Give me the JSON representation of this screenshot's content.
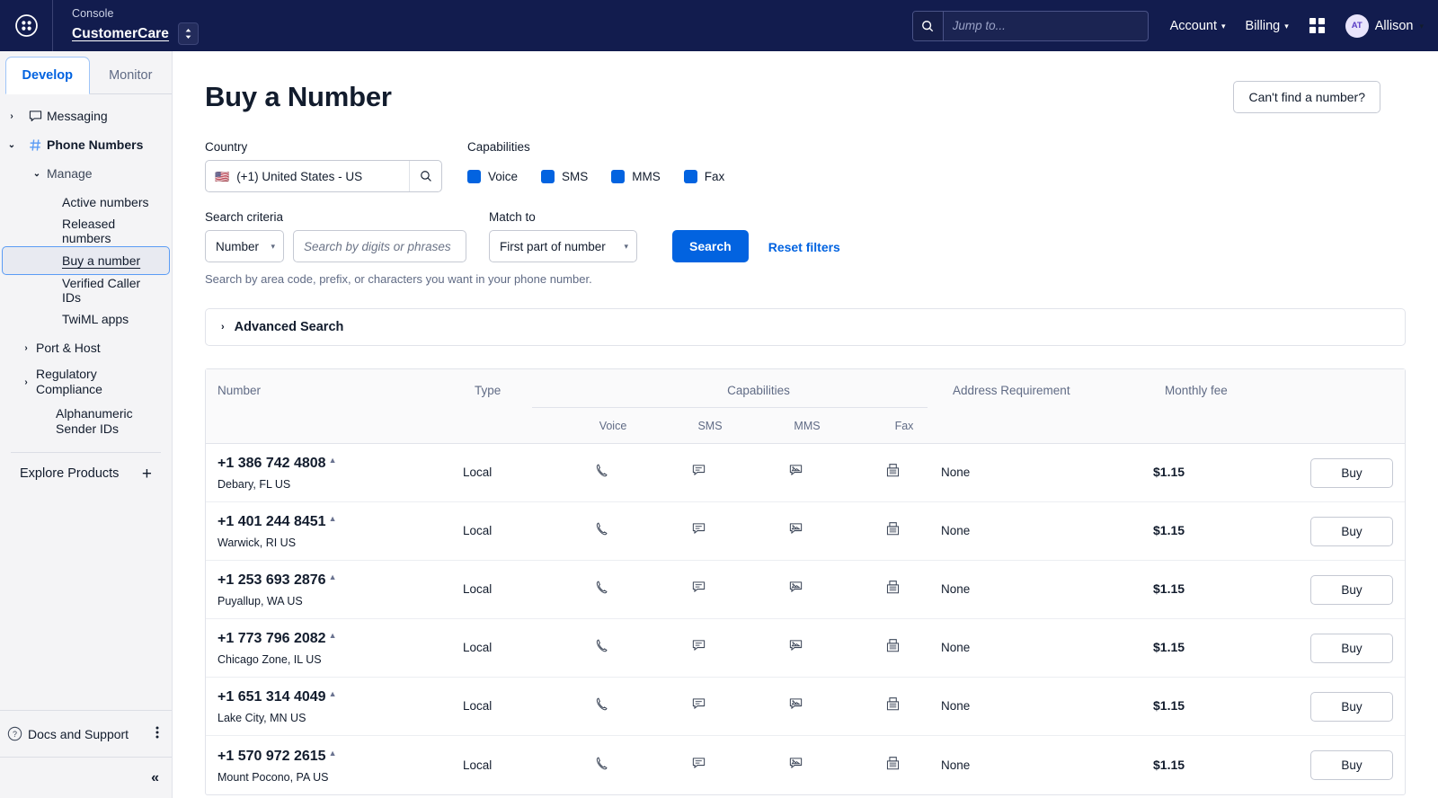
{
  "topbar": {
    "logo_icon": "twilio-grid-logo-icon",
    "console_label": "Console",
    "account_name": "CustomerCare",
    "account_switcher_icon": "up-down-chevron-icon",
    "search": {
      "icon": "search-icon",
      "placeholder": "Jump to...",
      "value": ""
    },
    "menus": [
      {
        "label": "Account",
        "icon": "chevron-down-icon"
      },
      {
        "label": "Billing",
        "icon": "chevron-down-icon"
      }
    ],
    "apps_icon": "apps-grid-icon",
    "user": {
      "initials": "AT",
      "name": "Allison",
      "icon": "chevron-down-icon"
    }
  },
  "sidebar": {
    "tabs": [
      {
        "label": "Develop",
        "active": true
      },
      {
        "label": "Monitor",
        "active": false
      }
    ],
    "nav": {
      "messaging": {
        "label": "Messaging",
        "icon": "chat-bubble-icon",
        "chevron": "chevron-right-icon"
      },
      "phone_numbers": {
        "label": "Phone Numbers",
        "icon": "hash-icon",
        "chevron": "chevron-down-icon"
      },
      "manage": {
        "label": "Manage",
        "chevron": "chevron-down-icon"
      },
      "leaves": [
        {
          "label": "Active numbers",
          "selected": false
        },
        {
          "label": "Released numbers",
          "selected": false
        },
        {
          "label": "Buy a number",
          "selected": true
        },
        {
          "label": "Verified Caller IDs",
          "selected": false
        },
        {
          "label": "TwiML apps",
          "selected": false
        }
      ],
      "expandables": [
        {
          "label": "Port & Host",
          "chevron": "chevron-right-icon"
        },
        {
          "label": "Regulatory Compliance",
          "chevron": "chevron-right-icon"
        }
      ],
      "alphanumeric": {
        "label": "Alphanumeric Sender IDs"
      }
    },
    "explore_products": {
      "label": "Explore Products",
      "icon": "plus-icon"
    },
    "docs_support": {
      "label": "Docs and Support",
      "icon": "question-circle-icon",
      "menu_icon": "kebab-menu-icon"
    },
    "collapse": {
      "icon": "double-chevron-left-icon"
    }
  },
  "page": {
    "title": "Buy a Number",
    "cant_find_button": "Can't find a number?"
  },
  "form": {
    "country": {
      "label": "Country",
      "flag": "🇺🇸",
      "value": "(+1) United States - US",
      "search_icon": "search-icon"
    },
    "capabilities": {
      "label": "Capabilities",
      "items": [
        {
          "label": "Voice",
          "checked": true
        },
        {
          "label": "SMS",
          "checked": true
        },
        {
          "label": "MMS",
          "checked": true
        },
        {
          "label": "Fax",
          "checked": true
        }
      ],
      "checkbox_color": "#0263e0"
    },
    "search_criteria": {
      "label": "Search criteria",
      "select_value": "Number",
      "input_placeholder": "Search by digits or phrases",
      "input_value": ""
    },
    "match_to": {
      "label": "Match to",
      "select_value": "First part of number"
    },
    "search_button": "Search",
    "reset_link": "Reset filters",
    "helper_text": "Search by area code, prefix, or characters you want in your phone number.",
    "primary_color": "#0263e0"
  },
  "advanced_search": {
    "label": "Advanced Search",
    "chevron": "chevron-right-icon",
    "expanded": false
  },
  "table": {
    "headers": {
      "number": "Number",
      "type": "Type",
      "capabilities": "Capabilities",
      "address_requirement": "Address Requirement",
      "monthly_fee": "Monthly fee"
    },
    "capability_subheaders": [
      "Voice",
      "SMS",
      "MMS",
      "Fax"
    ],
    "buy_label": "Buy",
    "rows": [
      {
        "number": "+1 386 742 4808",
        "badge_icon": "beta-triangle-icon",
        "location": "Debary, FL US",
        "type": "Local",
        "capabilities": {
          "voice": "phone-icon",
          "sms": "sms-bubble-icon",
          "mms": "mms-image-bubble-icon",
          "fax": "fax-machine-icon"
        },
        "address_requirement": "None",
        "monthly_fee": "$1.15",
        "buy": "Buy"
      },
      {
        "number": "+1 401 244 8451",
        "badge_icon": "beta-triangle-icon",
        "location": "Warwick, RI US",
        "type": "Local",
        "capabilities": {
          "voice": "phone-icon",
          "sms": "sms-bubble-icon",
          "mms": "mms-image-bubble-icon",
          "fax": "fax-machine-icon"
        },
        "address_requirement": "None",
        "monthly_fee": "$1.15",
        "buy": "Buy"
      },
      {
        "number": "+1 253 693 2876",
        "badge_icon": "beta-triangle-icon",
        "location": "Puyallup, WA US",
        "type": "Local",
        "capabilities": {
          "voice": "phone-icon",
          "sms": "sms-bubble-icon",
          "mms": "mms-image-bubble-icon",
          "fax": "fax-machine-icon"
        },
        "address_requirement": "None",
        "monthly_fee": "$1.15",
        "buy": "Buy"
      },
      {
        "number": "+1 773 796 2082",
        "badge_icon": "beta-triangle-icon",
        "location": "Chicago Zone, IL US",
        "type": "Local",
        "capabilities": {
          "voice": "phone-icon",
          "sms": "sms-bubble-icon",
          "mms": "mms-image-bubble-icon",
          "fax": "fax-machine-icon"
        },
        "address_requirement": "None",
        "monthly_fee": "$1.15",
        "buy": "Buy"
      },
      {
        "number": "+1 651 314 4049",
        "badge_icon": "beta-triangle-icon",
        "location": "Lake City, MN US",
        "type": "Local",
        "capabilities": {
          "voice": "phone-icon",
          "sms": "sms-bubble-icon",
          "mms": "mms-image-bubble-icon",
          "fax": "fax-machine-icon"
        },
        "address_requirement": "None",
        "monthly_fee": "$1.15",
        "buy": "Buy"
      },
      {
        "number": "+1 570 972 2615",
        "badge_icon": "beta-triangle-icon",
        "location": "Mount Pocono, PA US",
        "type": "Local",
        "capabilities": {
          "voice": "phone-icon",
          "sms": "sms-bubble-icon",
          "mms": "mms-image-bubble-icon",
          "fax": "fax-machine-icon"
        },
        "address_requirement": "None",
        "monthly_fee": "$1.15",
        "buy": "Buy"
      }
    ]
  }
}
